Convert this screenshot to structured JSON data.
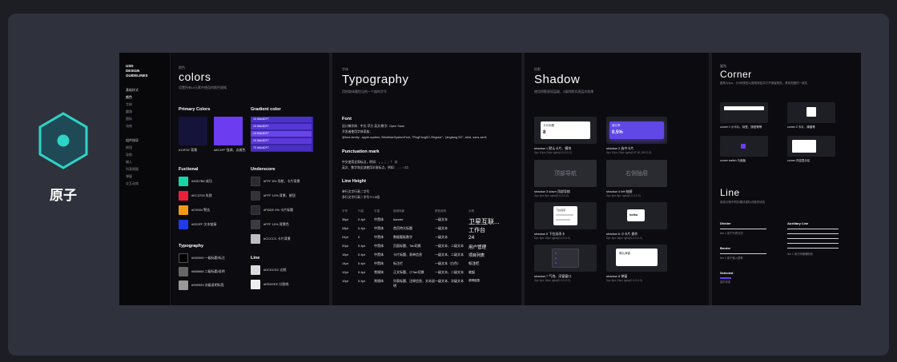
{
  "atom": {
    "label": "原子",
    "color": "#2dd4c8"
  },
  "sidebar": {
    "title_lines": [
      "USD",
      "DESIGN",
      "GUIDELINES"
    ],
    "section1": "基础样式",
    "items1": [
      "颜色",
      "字体",
      "圆角",
      "图标",
      "动效"
    ],
    "section2": "组件指导",
    "items2": [
      "按钮",
      "导航",
      "输入",
      "列表视图",
      "弹窗",
      "交互动效"
    ]
  },
  "colors": {
    "small": "颜色",
    "title": "colors",
    "desc": "设置所有UI元素中使用的颜色规格",
    "primary_label": "Primary Colors",
    "gradient_label": "Gradient color",
    "primary": [
      {
        "name": "#13F2E 背景",
        "hex": "#15133a"
      },
      {
        "name": "#8C4FF 强调、点缀色",
        "hex": "#6b3cf0"
      }
    ],
    "gradient_rows": [
      "10 #6A4DF7",
      "10 #6A4DF7",
      "10 #6A4DF7",
      "10 #6A4DF7",
      "70 #6A4DF7"
    ],
    "functional_label": "Fuctional",
    "functional": [
      {
        "name": "#00D7B6 成功",
        "hex": "#16d6a8"
      },
      {
        "name": "#EC3700 失败",
        "hex": "#ec1f3b"
      },
      {
        "name": "#C9004 警告",
        "hex": "#f29a16"
      },
      {
        "name": "#0D3FF 文本链接",
        "hex": "#1f3bea"
      }
    ],
    "underscore_label": "Underscore",
    "underscore": [
      {
        "name": "#FFF 8% 导航、卡片背景",
        "hex": "#2a2a30"
      },
      {
        "name": "#FFF 10% 背景、按钮",
        "hex": "#333339"
      },
      {
        "name": "#FDDE 0% 卡片标题",
        "hex": "#2b2b31"
      },
      {
        "name": "#FFF 10% 背景色",
        "hex": "#3b3b42"
      },
      {
        "name": "#CCCCC 卡片背景",
        "hex": "#bdbdc4"
      }
    ],
    "typography_label": "Typography",
    "typography": [
      {
        "name": "#000000 一级标题/标注",
        "hex": "#000000"
      },
      {
        "name": "#666666 二级标题/说明",
        "hex": "#666666"
      },
      {
        "name": "#999999 次级说明标签",
        "hex": "#999999"
      }
    ],
    "line_label": "Line",
    "line": [
      {
        "name": "#DCDCDC 边框",
        "hex": "#dcdcdc"
      },
      {
        "name": "#EEEEEE 分割线",
        "hex": "#eeeeee"
      }
    ]
  },
  "typography": {
    "small": "字体",
    "title": "Typography",
    "desc": "用恰取体最恰当的一个维的字号",
    "font_label": "Font",
    "font_lines": [
      "设计稿字体：中文-苹方 英文/数字- Open Sans",
      "开发者使用字体家族：",
      "@font-family: -apple-system, BlinkMacSystemFont, \"PingFangSC-Regular\", \"pingfang SC\", Arial, sans-serif;"
    ],
    "punct_label": "Punctuation mark",
    "punct_lines": [
      "中文使用全角标点，例如：，。；：！ 口",
      "英文、数字和全部使用半角标点，例如：, . ; : ! 口"
    ],
    "lh_label": "Line Height",
    "lh_lines": [
      "单行文字行高＝字号",
      "多行文字行高＝字号＊1.5倍"
    ],
    "table_header": [
      "字号",
      "行高",
      "字重",
      "使用场景",
      "颜色说明",
      "示例"
    ],
    "table_rows": [
      [
        "36pt",
        "0.4pt",
        "中黑体",
        "banner",
        "一级文本",
        "卫星互联..."
      ],
      [
        "28pt",
        "0.4pt",
        "中黑体",
        "首页特大标题",
        "一级文本",
        "工作台"
      ],
      [
        "24pt",
        "0",
        "中黑体",
        "数据看板数字",
        "一级文本",
        "24"
      ],
      [
        "20pt",
        "0.4pt",
        "中黑体",
        "页面标题、Tab切换",
        "一级文本、二级文本",
        "用户管理"
      ],
      [
        "16pt",
        "0.4pt",
        "中黑体",
        "卡片标题、表单信息",
        "一级文本、二级文本",
        "项目列表"
      ],
      [
        "14pt",
        "0.4pt",
        "中黑体",
        "标注栏",
        "一级文本（白色）",
        "标注栏"
      ],
      [
        "12pt",
        "0.4pt",
        "常规体",
        "正文标题、小Tab切换",
        "一级文本、二级文本",
        "收起"
      ],
      [
        "10pt",
        "0.4pt",
        "常规体",
        "列表标题、注释信息、文本说明",
        "一级文本、次级文本",
        "说明信息"
      ]
    ]
  },
  "shadow": {
    "small": "投影",
    "title": "Shadow",
    "desc": "使用阴影表现层级，2级阴影实现层次效果",
    "cards": [
      {
        "caption": "shadow 1 默认卡片、模块",
        "spec": "0px 10px 20px rgba(0,0,0,0.2)",
        "inner": "卡片标题",
        "inner2": "8"
      },
      {
        "caption": "shadow 2 选中卡片",
        "spec": "0px 10px 20px rgba(107,61,240,0.4)",
        "inner": "增长率",
        "inner2": "0.5%"
      },
      {
        "caption": "shadow 3 down 顶部导航",
        "spec": "0px 4px 8px rgba(0,0,0,0.2)",
        "inner": "顶部导航"
      },
      {
        "caption": "shadow 4 left 抽屉",
        "spec": "0px 4px 8px rgba(0,0,0,0.2)",
        "inner": "右侧抽屉"
      },
      {
        "caption": "shadow 5 下拉选项卡",
        "spec": "0px 4px 16px rgba(0,0,0,0.2)",
        "inner": "下拉选项"
      },
      {
        "caption": "shadow 6 小卡片 操作",
        "spec": "0px 4px 16px rgba(0,0,0,0.2)",
        "inner": "kafka"
      },
      {
        "caption": "shadow 7 气泡、浮窗窗口",
        "spec": "0px 4px 16px rgba(0,0,0,0.2)",
        "inner": "气泡"
      },
      {
        "caption": "shadow 8 弹窗",
        "spec": "0px 8px 24px rgba(0,0,0,0.3)",
        "inner": "确认弹窗"
      }
    ]
  },
  "corner": {
    "small": "圆角",
    "title": "Corner",
    "desc": "圆角为4px，分4种类型以展现按钮并打开弹窗规范，具体视图的一致性",
    "items": [
      {
        "caption": "corner 1 小卡片、标签、按钮等等"
      },
      {
        "caption": "corner 2 卡片、弹窗等"
      },
      {
        "caption": "corner switch 与面板"
      },
      {
        "caption": "corner 内容显示区"
      }
    ]
  },
  "line": {
    "title": "Line",
    "desc": "用线分割不同的模块或标识操作状态",
    "divider_label": "Divider",
    "divider_note": "line 1 用于列表分割",
    "auxiliary_label": "Auxiliary Line",
    "auxiliary_note": "line 1 用于网格辅助线",
    "border_label": "Border",
    "border_note": "line 1 用于输入框等",
    "selected_label": "Selected",
    "selected_note": "选中状态"
  }
}
